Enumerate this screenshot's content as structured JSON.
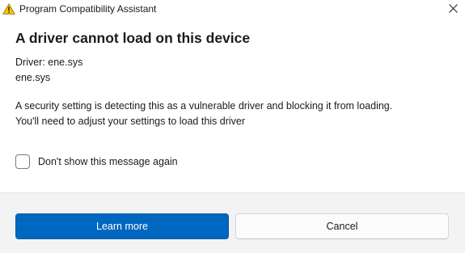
{
  "window": {
    "title": "Program Compatibility Assistant",
    "title_icon": "warning-icon",
    "close_icon": "close-icon"
  },
  "dialog": {
    "heading": "A driver cannot load on this device",
    "driver_label": "Driver: ene.sys",
    "driver_file": "ene.sys",
    "message_line1": "A security setting is detecting this as a vulnerable driver and blocking it from loading.",
    "message_line2": "You'll need to adjust your settings to load this driver"
  },
  "checkbox": {
    "label": "Don't show this message again",
    "checked": false
  },
  "buttons": {
    "primary_label": "Learn more",
    "secondary_label": "Cancel"
  },
  "colors": {
    "accent": "#0067c0",
    "warning": "#f5c400",
    "footer_bg": "#f3f3f3"
  }
}
